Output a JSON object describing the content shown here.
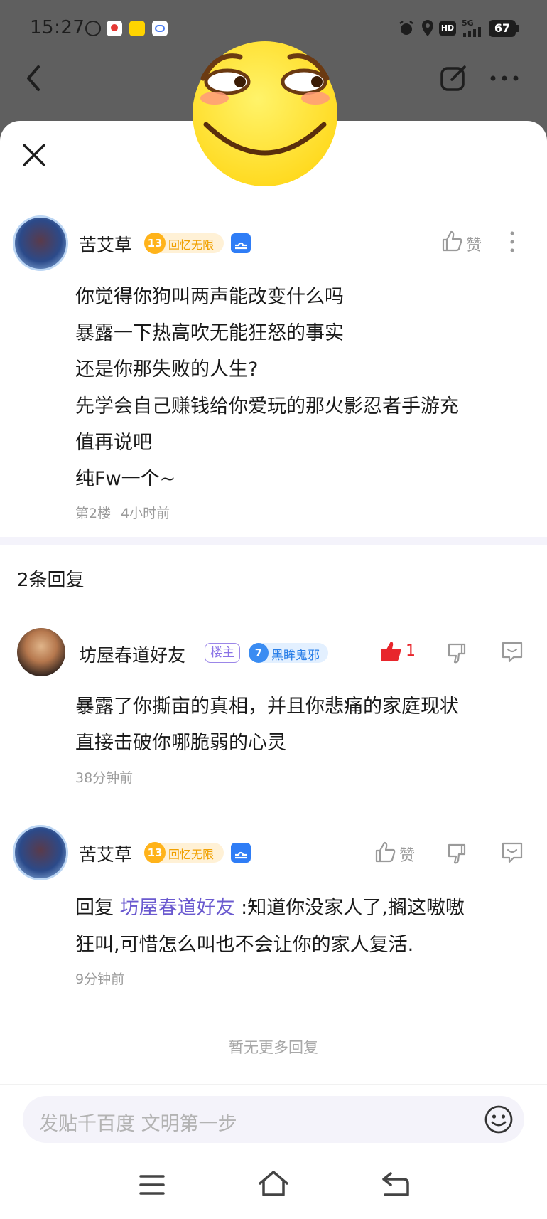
{
  "status_bar": {
    "time": "15:27",
    "battery": "67",
    "network": "5G",
    "hd": "HD"
  },
  "colors": {
    "accent_purple": "#6a59cf",
    "like_red": "#e8262c",
    "level_gold": "#ffb31a",
    "fan_blue": "#3a8cf2"
  },
  "main_post": {
    "author": "苦艾草",
    "level": "13",
    "level_title": "回忆无限",
    "like_label": "赞",
    "lines": [
      "你觉得你狗叫两声能改变什么吗",
      "暴露一下热高吹无能狂怒的事实",
      "还是你那失败的人生?",
      "先学会自己赚钱给你爱玩的那火影忍者手游充",
      "值再说吧",
      "纯Fw一个~"
    ],
    "floor": "第2楼",
    "time": "4小时前"
  },
  "reply_section": {
    "count_label": "2条回复",
    "no_more": "暂无更多回复"
  },
  "replies": [
    {
      "author": "坊屋春道好友",
      "owner_tag": "楼主",
      "fan_level": "7",
      "fan_title": "黑眸鬼邪",
      "like_count": "1",
      "lines": [
        "暴露了你撕亩的真相，并且你悲痛的家庭现状",
        "直接击破你哪脆弱的心灵"
      ],
      "time": "38分钟前"
    },
    {
      "author": "苦艾草",
      "level": "13",
      "level_title": "回忆无限",
      "like_label": "赞",
      "reply_prefix": "回复 ",
      "mention": "坊屋春道好友",
      "line1_rest": "  :知道你没家人了,搁这嗷嗷",
      "line2": "狂叫,可惜怎么叫也不会让你的家人复活.",
      "time": "9分钟前"
    }
  ],
  "compose": {
    "placeholder": "发贴千百度 文明第一步"
  },
  "icons": [
    "back-arrow-icon",
    "edit-icon",
    "more-icon",
    "close-icon",
    "thumbs-up-icon",
    "thumbs-down-icon",
    "comment-icon",
    "emoji-icon",
    "menu-icon",
    "home-icon",
    "return-icon",
    "smiley-sticker-icon"
  ]
}
